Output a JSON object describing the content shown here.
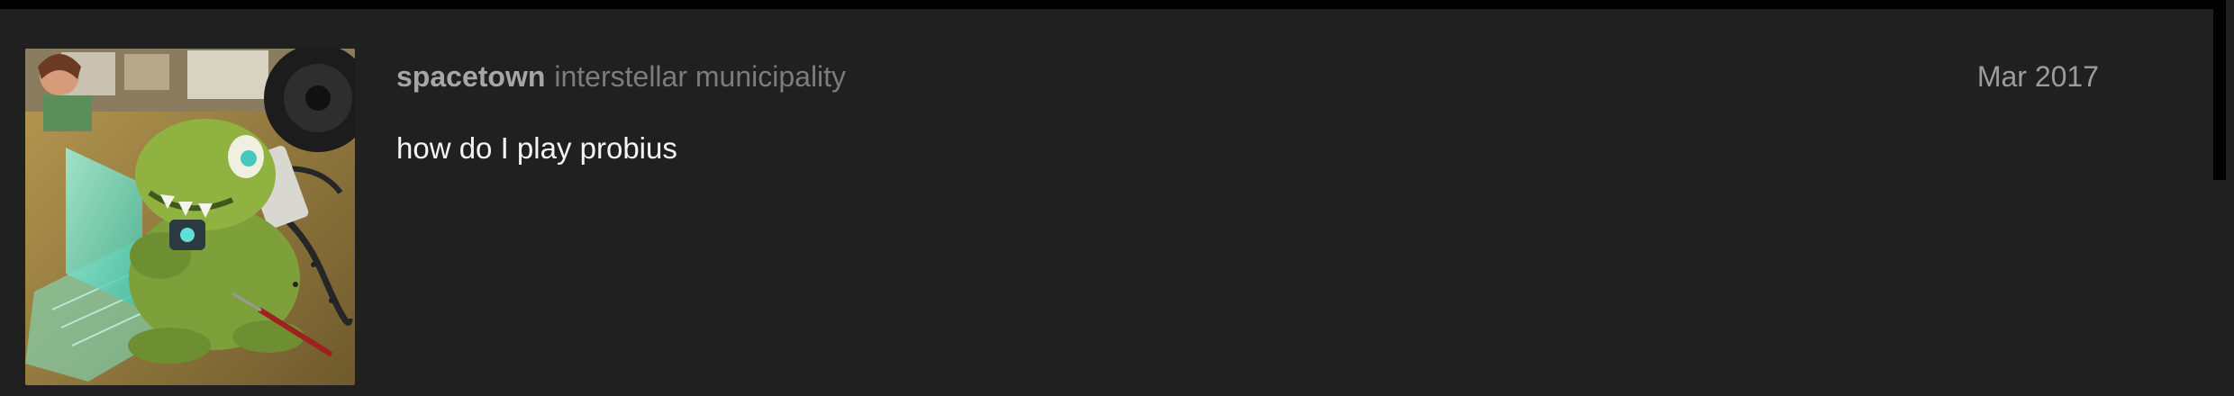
{
  "post": {
    "username": "spacetown",
    "user_title": "interstellar municipality",
    "date": "Mar 2017",
    "body": "how do I play probius",
    "avatar_icon": "robot-dinosaur-avatar"
  },
  "colors": {
    "background": "#202020",
    "username": "#a6a6a6",
    "user_title": "#7c7c7c",
    "date": "#9c9c9c",
    "body_text": "#f4f4f4"
  }
}
